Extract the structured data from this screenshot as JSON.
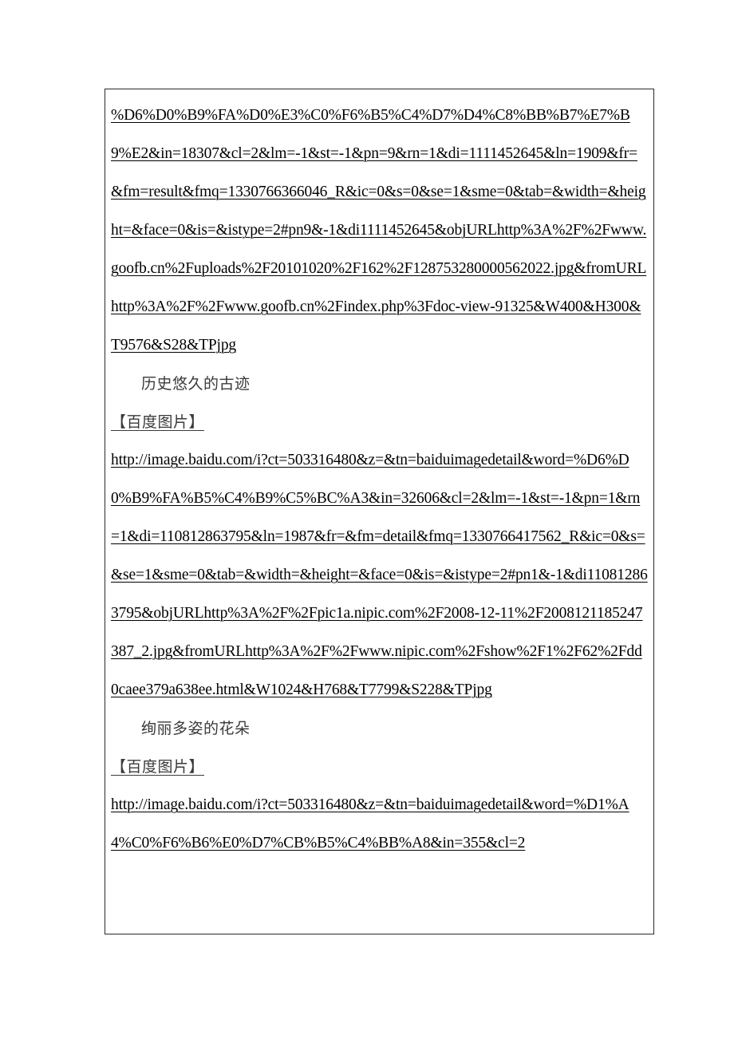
{
  "document": {
    "page_background": "#ffffff",
    "frame_border_color": "#2a2a2a",
    "link_text_color": "#000000",
    "heading_text_color": "#3a3a3a",
    "blocks": [
      {
        "kind": "url-continuation",
        "name": "baidu-image-url-1",
        "text": "%D6%D0%B9%FA%D0%E3%C0%F6%B5%C4%D7%D4%C8%BB%B7%E7%B9%E2&in=18307&cl=2&lm=-1&st=-1&pn=9&rn=1&di=1111452645&ln=1909&fr=&fm=result&fmq=1330766366046_R&ic=0&s=0&se=1&sme=0&tab=&width=&height=&face=0&is=&istype=2#pn9&-1&di1111452645&objURLhttp%3A%2F%2Fwww.goofb.cn%2Fuploads%2F20101020%2F162%2F128753280000562022.jpg&fromURLhttp%3A%2F%2Fwww.goofb.cn%2Findex.php%3Fdoc-view-91325&W400&H300&T9576&S28&TPjpg"
      },
      {
        "kind": "heading",
        "name": "section-heading-historic-sites",
        "text": "历史悠久的古迹"
      },
      {
        "kind": "tag",
        "name": "baidu-image-tag-1",
        "text": "【百度图片】"
      },
      {
        "kind": "url",
        "name": "baidu-image-url-2",
        "text": "http://image.baidu.com/i?ct=503316480&z=&tn=baiduimagedetail&word=%D6%D0%B9%FA%B5%C4%B9%C5%BC%A3&in=32606&cl=2&lm=-1&st=-1&pn=1&rn=1&di=110812863795&ln=1987&fr=&fm=detail&fmq=1330766417562_R&ic=0&s=&se=1&sme=0&tab=&width=&height=&face=0&is=&istype=2#pn1&-1&di110812863795&objURLhttp%3A%2F%2Fpic1a.nipic.com%2F2008-12-11%2F2008121185247387_2.jpg&fromURLhttp%3A%2F%2Fwww.nipic.com%2Fshow%2F1%2F62%2Fdd0caee379a638ee.html&W1024&H768&T7799&S228&TPjpg"
      },
      {
        "kind": "heading",
        "name": "section-heading-colorful-flowers",
        "text": "绚丽多姿的花朵"
      },
      {
        "kind": "tag",
        "name": "baidu-image-tag-2",
        "text": "【百度图片】"
      },
      {
        "kind": "url",
        "name": "baidu-image-url-3",
        "text": "http://image.baidu.com/i?ct=503316480&z=&tn=baiduimagedetail&word=%D1%A4%C0%F6%B6%E0%D7%CB%B5%C4%BB%A8&in=355&cl=2"
      }
    ]
  }
}
